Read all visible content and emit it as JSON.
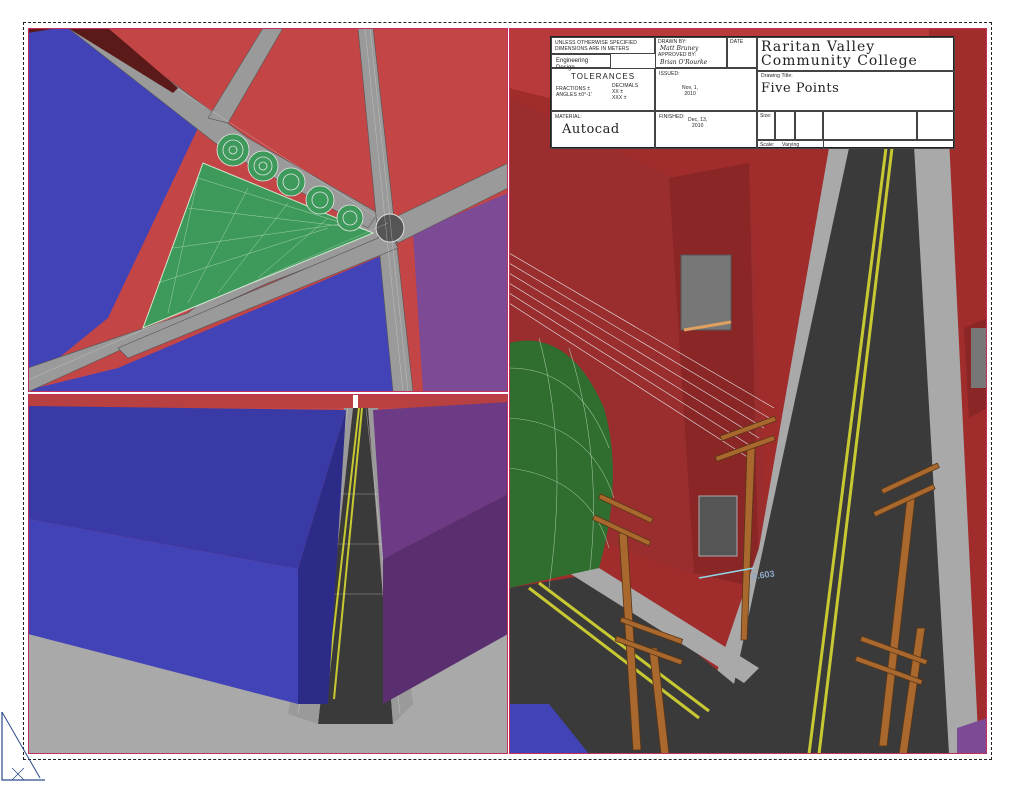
{
  "title_block": {
    "general_note": "UNLESS OTHERWISE SPECIFIED\nDIMENSIONS ARE IN METERS",
    "drawn_by_label": "DRAWN BY:",
    "drawn_by": "Matt Bruney",
    "approved_by_label": "APPROVED BY:",
    "approved_by": "Brian O'Rourke",
    "date_label": "DATE",
    "course": "Engineering Design",
    "tolerances_title": "TOLERANCES",
    "fractions": "FRACTIONS ±\nANGLES ±0°-1'",
    "decimals": "DECIMALS\nXX ±\nXXX ±",
    "issued_label": "ISSUED:",
    "issued": "Nov, 1,\n2010",
    "material_label": "MATERIAL:",
    "material": "Autocad",
    "finished_label": "FINISHED:",
    "finished": "Dec, 13,\n2010",
    "school_line1": "Raritan Valley",
    "school_line2": "Community College",
    "drawing_title_label": "Drawing Title:",
    "drawing_title": "Five Points",
    "size_label": "Size:",
    "scale_label": "Scale:",
    "scale": "Varying"
  },
  "dimension_text": "0.603",
  "colors": {
    "building_red": "#c44545",
    "building_blue": "#4343b8",
    "building_purple": "#7d4a95",
    "grass_green": "#3d9a5a",
    "road_dark": "#3a3a3a",
    "sidewalk_gray": "#a9a9a9",
    "pole_brown": "#a8682e",
    "line_yellow": "#c8c832",
    "viewport_border": "#c0305a"
  }
}
